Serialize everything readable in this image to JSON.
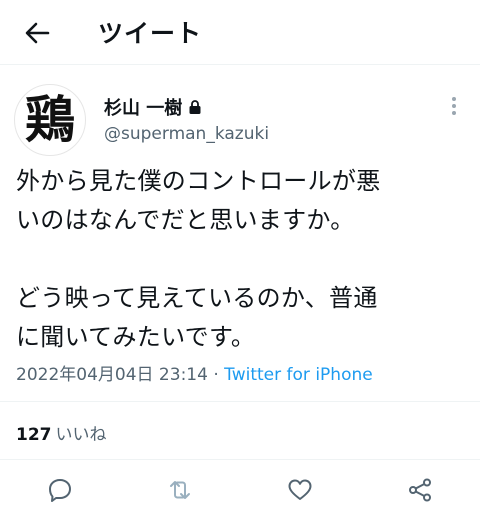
{
  "header": {
    "title": "ツイート",
    "back_icon": "arrow-left-icon"
  },
  "tweet": {
    "avatar_glyph": "鶏",
    "display_name": "杉山 一樹",
    "handle": "@superman_kazuki",
    "protected_icon": "lock-icon",
    "more_icon": "more-vertical-icon",
    "text_lines": [
      "外から見た僕のコントロールが悪",
      "いのはなんでだと思いますか。",
      "",
      "どう映って見えているのか、普通",
      "に聞いてみたいです。"
    ],
    "date": "2022年04月04日 23:14",
    "separator": "·",
    "source": "Twitter for iPhone",
    "likes": {
      "count": "127",
      "label": "いいね"
    }
  },
  "actions": [
    {
      "name": "reply",
      "icon": "reply-icon"
    },
    {
      "name": "retweet",
      "icon": "retweet-icon"
    },
    {
      "name": "like",
      "icon": "heart-icon"
    },
    {
      "name": "share",
      "icon": "share-icon"
    }
  ],
  "colors": {
    "accent": "#1d9bf0",
    "text": "#0f1419",
    "muted": "#536471",
    "disabled": "#9ab0bf"
  }
}
